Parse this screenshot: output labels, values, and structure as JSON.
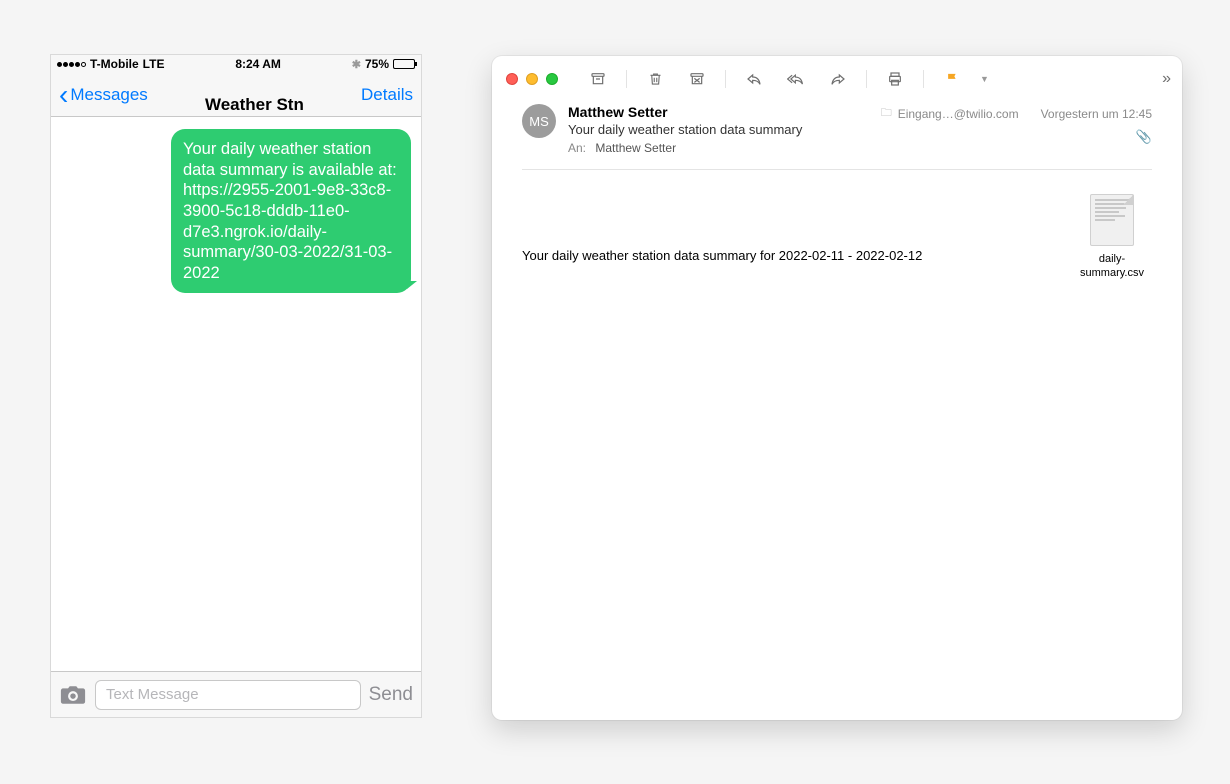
{
  "phone": {
    "status": {
      "carrier": "T-Mobile",
      "network": "LTE",
      "time": "8:24 AM",
      "battery_pct": "75%"
    },
    "nav": {
      "back_label": "Messages",
      "title": "Weather Stn",
      "details_label": "Details"
    },
    "message": {
      "text": "Your daily weather station data summary is available at: https://2955-2001-9e8-33c8-3900-5c18-dddb-11e0-d7e3.ngrok.io/daily-summary/30-03-2022/31-03-2022"
    },
    "compose": {
      "placeholder": "Text Message",
      "send_label": "Send"
    }
  },
  "mail": {
    "header": {
      "avatar_initials": "MS",
      "from_name": "Matthew Setter",
      "subject": "Your daily weather station data summary",
      "to_label": "An:",
      "to_value": "Matthew Setter",
      "mailbox": "Eingang…@twilio.com",
      "date": "Vorgestern um 12:45"
    },
    "body_text": "Your daily weather station data summary for 2022-02-11 - 2022-02-12",
    "attachment": {
      "filename": "daily-summary.csv"
    }
  }
}
